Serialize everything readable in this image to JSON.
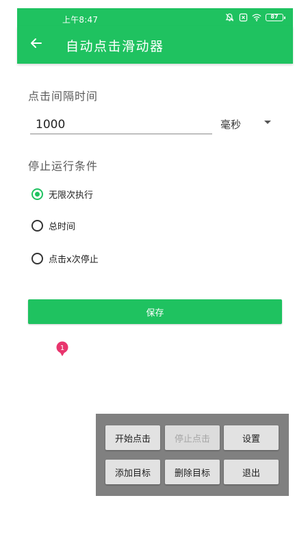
{
  "status_bar": {
    "time": "上午8:47",
    "battery": "87",
    "icons": [
      "bell-off-icon",
      "sim-x-icon",
      "wifi-icon",
      "battery-icon"
    ]
  },
  "toolbar": {
    "back_icon": "arrow-left-icon",
    "title": "自动点击滑动器",
    "background": "#1fc260"
  },
  "interval": {
    "label": "点击间隔时间",
    "value": "1000",
    "unit": "毫秒"
  },
  "stop_condition": {
    "label": "停止运行条件",
    "options": [
      {
        "label": "无限次执行",
        "checked": true
      },
      {
        "label": "总时间",
        "checked": false
      },
      {
        "label": "点击x次停止",
        "checked": false
      }
    ]
  },
  "save_button": {
    "label": "保存"
  },
  "marker": {
    "number": "1",
    "color": "#e8356d"
  },
  "control_panel": {
    "buttons": [
      {
        "label": "开始点击",
        "enabled": true
      },
      {
        "label": "停止点击",
        "enabled": false
      },
      {
        "label": "设置",
        "enabled": true
      },
      {
        "label": "添加目标",
        "enabled": true
      },
      {
        "label": "删除目标",
        "enabled": true
      },
      {
        "label": "退出",
        "enabled": true
      }
    ]
  }
}
